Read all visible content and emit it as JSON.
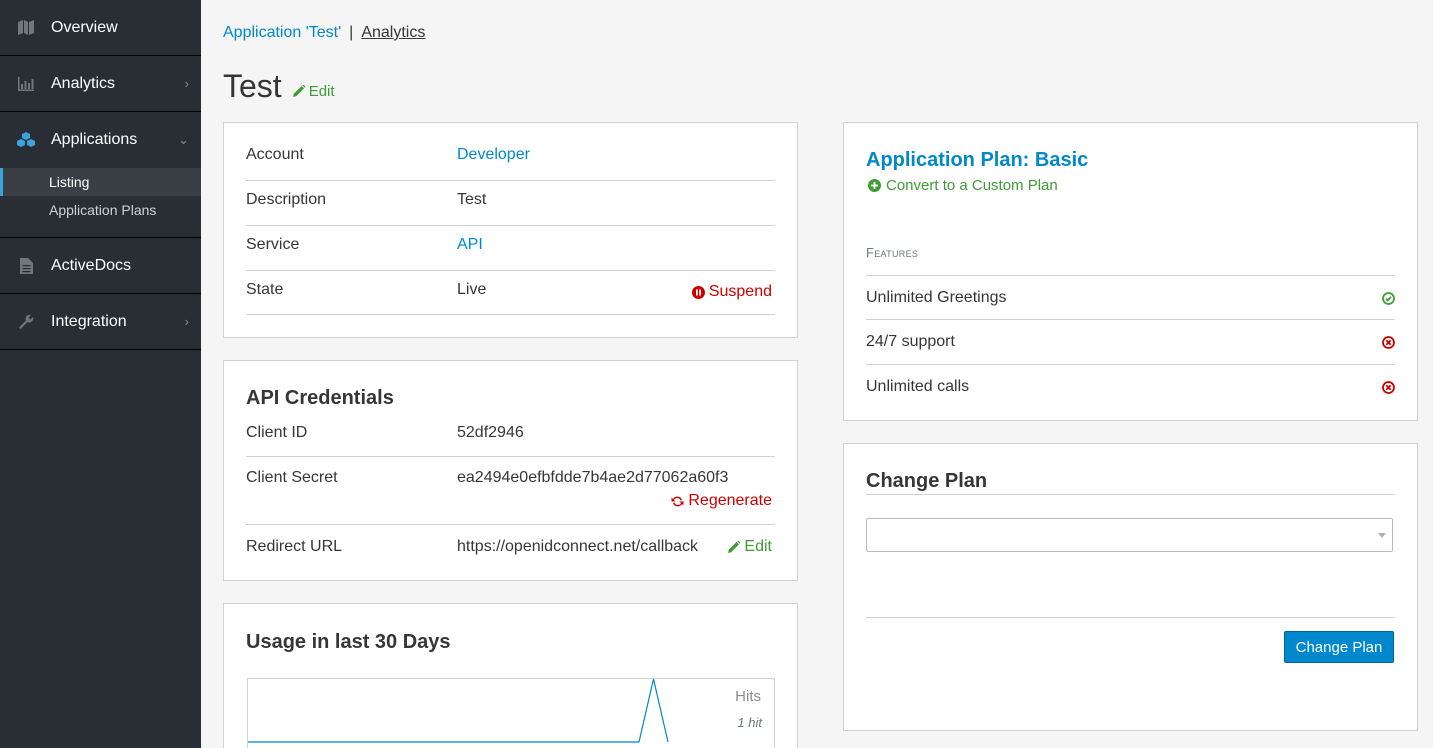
{
  "sidebar": {
    "items": [
      {
        "label": "Overview",
        "icon": "map-icon"
      },
      {
        "label": "Analytics",
        "icon": "bar-chart-icon"
      },
      {
        "label": "Applications",
        "icon": "cubes-icon"
      },
      {
        "label": "ActiveDocs",
        "icon": "document-icon"
      },
      {
        "label": "Integration",
        "icon": "wrench-icon"
      }
    ],
    "sub_items": [
      {
        "label": "Listing"
      },
      {
        "label": "Application Plans"
      }
    ]
  },
  "breadcrumb": {
    "parent": "Application 'Test'",
    "separator": "|",
    "current": "Analytics"
  },
  "page": {
    "title": "Test",
    "edit_label": "Edit"
  },
  "details": {
    "rows": [
      {
        "key": "Account",
        "value": "Developer"
      },
      {
        "key": "Description",
        "value": "Test"
      },
      {
        "key": "Service",
        "value": "API"
      },
      {
        "key": "State",
        "value": "Live",
        "action": "Suspend"
      }
    ]
  },
  "credentials": {
    "title": "API Credentials",
    "rows": [
      {
        "key": "Client ID",
        "value": "52df2946"
      },
      {
        "key": "Client Secret",
        "value": "ea2494e0efbfdde7b4ae2d77062a60f3",
        "action": "Regenerate"
      },
      {
        "key": "Redirect URL",
        "value": "https://openidconnect.net/callback",
        "action": "Edit"
      }
    ]
  },
  "usage": {
    "title": "Usage in last 30 Days"
  },
  "chart_data": {
    "type": "line",
    "series": [
      {
        "name": "Hits",
        "values": [
          0,
          0,
          0,
          0,
          0,
          0,
          0,
          0,
          0,
          0,
          0,
          0,
          0,
          0,
          0,
          0,
          0,
          0,
          0,
          0,
          0,
          0,
          0,
          0,
          0,
          0,
          0,
          0,
          1,
          0
        ]
      }
    ],
    "ytick_label": "1 hit",
    "line_color": "#0088ce"
  },
  "plan": {
    "title": "Application Plan: Basic",
    "convert_label": "Convert to a Custom Plan",
    "features_label": "Features",
    "features": [
      {
        "label": "Unlimited Greetings",
        "enabled": true
      },
      {
        "label": "24/7 support",
        "enabled": false
      },
      {
        "label": "Unlimited calls",
        "enabled": false
      }
    ]
  },
  "change_plan": {
    "title": "Change Plan",
    "select_value": "",
    "button_label": "Change Plan"
  },
  "colors": {
    "accent": "#0088ce",
    "success": "#3f9c35",
    "danger": "#cc0000",
    "sidebar": "#292e34"
  }
}
